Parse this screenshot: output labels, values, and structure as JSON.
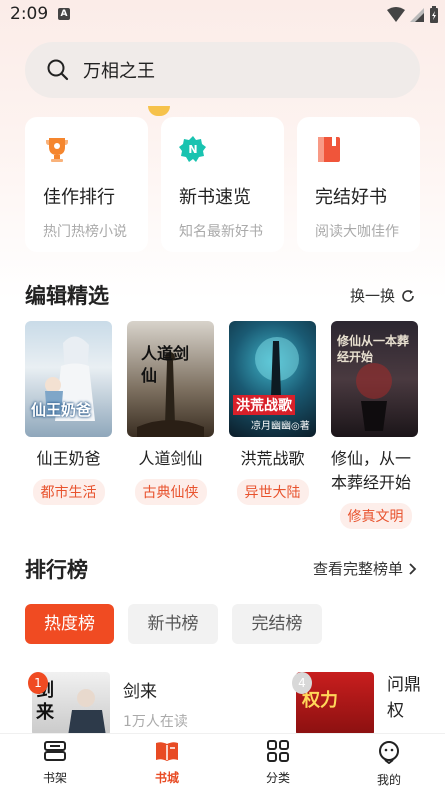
{
  "status": {
    "time": "2:09",
    "notif_icon": "A"
  },
  "search": {
    "placeholder": "万相之王"
  },
  "features": [
    {
      "title": "佳作排行",
      "subtitle": "热门热榜小说",
      "icon": "trophy-icon",
      "color": "#f5862e"
    },
    {
      "title": "新书速览",
      "subtitle": "知名最新好书",
      "icon": "new-badge-icon",
      "color": "#19c3b0"
    },
    {
      "title": "完结好书",
      "subtitle": "阅读大咖佳作",
      "icon": "book-icon",
      "color": "#f0553a"
    }
  ],
  "editor_picks": {
    "title": "编辑精选",
    "refresh_label": "换一换",
    "books": [
      {
        "title": "仙王奶爸",
        "tag": "都市生活",
        "cover_text": "仙王奶爸"
      },
      {
        "title": "人道剑仙",
        "tag": "古典仙侠",
        "cover_text": "人道剑仙"
      },
      {
        "title": "洪荒战歌",
        "tag": "异世大陆",
        "cover_text": "洪荒战歌",
        "cover_author": "凉月幽幽◎著"
      },
      {
        "title": "修仙，从一本葬经开始",
        "tag": "修真文明",
        "cover_text": "修仙从一本葬经开始"
      }
    ]
  },
  "ranking": {
    "title": "排行榜",
    "see_all_label": "查看完整榜单",
    "tabs": [
      "热度榜",
      "新书榜",
      "完结榜"
    ],
    "active_tab": 0,
    "items": [
      {
        "rank": "1",
        "name": "剑来",
        "readers": "1万人在读",
        "cover_text": "剑来"
      },
      {
        "rank": "4",
        "name": "问鼎权",
        "readers": "",
        "cover_text": "权力"
      }
    ]
  },
  "bottom_nav": [
    {
      "label": "书架",
      "icon": "bookshelf-icon"
    },
    {
      "label": "书城",
      "icon": "bookstore-icon"
    },
    {
      "label": "分类",
      "icon": "category-icon"
    },
    {
      "label": "我的",
      "icon": "profile-icon"
    }
  ],
  "active_nav": 1,
  "colors": {
    "accent": "#f04b22",
    "tag_text": "#e8532e",
    "tag_bg": "#fdeeea"
  }
}
